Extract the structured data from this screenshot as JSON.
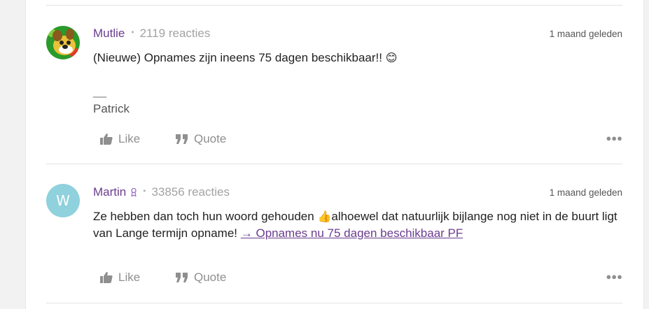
{
  "posts": [
    {
      "author": "Mutlie",
      "reactions": "2119 reacties",
      "time": "1 maand geleden",
      "text": "(Nieuwe) Opnames zijn ineens 75 dagen beschikbaar!!",
      "emoji": "😊",
      "signature_dash": "__",
      "signature": "Patrick",
      "like_label": "Like",
      "quote_label": "Quote",
      "avatar": "dog-cartoon-avatar"
    },
    {
      "author": "Martin",
      "author_badge_icon": "badge-icon",
      "reactions": "33856 reacties",
      "time": "1 maand geleden",
      "avatar_letter": "W",
      "avatar_color": "#8fd1dc",
      "text_before_emoji": "Ze hebben dan toch hun woord gehouden ",
      "emoji": "👍",
      "text_after_emoji": "alhoewel dat natuurlijk bijlange nog niet in de buurt ligt van Lange termijn opname! ",
      "link_text": "→ Opnames nu 75 dagen beschikbaar PF",
      "like_label": "Like",
      "quote_label": "Quote"
    }
  ],
  "colors": {
    "author": "#6a3c8e",
    "muted": "#a3a3a3",
    "link": "#6a3c8e"
  }
}
